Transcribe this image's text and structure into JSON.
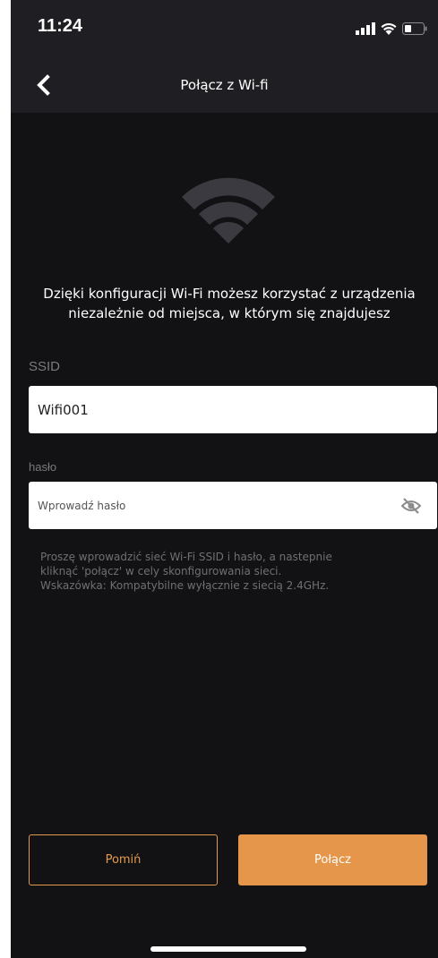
{
  "status_bar": {
    "time": "11:24",
    "icons": [
      "signal-icon",
      "wifi-icon",
      "battery-icon"
    ]
  },
  "header": {
    "back_icon": "chevron-left-icon",
    "title": "Połącz z Wi-fi"
  },
  "hero": {
    "icon": "wifi-icon"
  },
  "intro": {
    "line1": "Dzięki konfiguracji Wi-Fi możesz korzystać z urządzenia",
    "line2": "niezależnie od miejsca, w którym się znajdujesz"
  },
  "form": {
    "ssid_label": "SSID",
    "ssid_value": "Wifi001",
    "password_label": "hasło",
    "password_placeholder": "Wprowadź hasło",
    "password_value": "",
    "visibility_icon": "eye-off-icon"
  },
  "hint": {
    "line1": "Proszę wprowadzić sieć Wi-Fi SSID i hasło, a nastepnie",
    "line2": "kliknąć 'połącz' w cely skonfigurowania sieci.",
    "line3": "Wskazówka: Kompatybilne wyłącznie z siecią 2.4GHz."
  },
  "actions": {
    "skip_label": "Pomiń",
    "connect_label": "Połącz"
  },
  "colors": {
    "background": "#121215",
    "bar": "#1f1f23",
    "accent": "#e5964a",
    "muted_text": "#7a7a7f"
  }
}
